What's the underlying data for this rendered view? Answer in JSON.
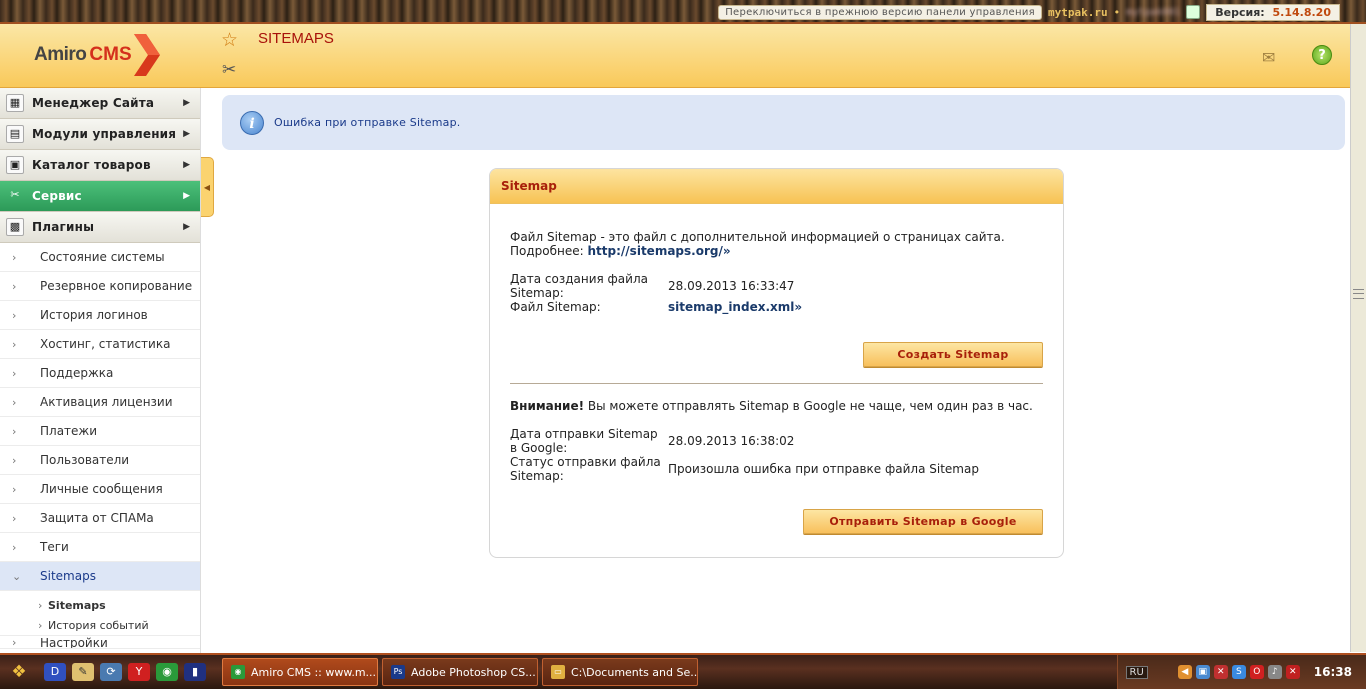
{
  "topbar": {
    "switch_label": "Переключиться в прежнюю версию панели управления",
    "site": "mytpak.ru",
    "user": "mytpak001",
    "version_label": "Версия:",
    "version": "5.14.8.20"
  },
  "header": {
    "logo_a": "Amiro",
    "logo_b": "CMS",
    "title": "SITEMAPS",
    "colors": {
      "title": "#a8120a",
      "header_bg": "#f9c95a"
    }
  },
  "sidebar": {
    "sections": [
      {
        "label": "Менеджер Сайта",
        "icon": "site-manager-icon"
      },
      {
        "label": "Модули управления",
        "icon": "modules-icon"
      },
      {
        "label": "Каталог товаров",
        "icon": "catalog-icon"
      },
      {
        "label": "Сервис",
        "icon": "service-tools-icon",
        "active": true
      },
      {
        "label": "Плагины",
        "icon": "plugins-icon"
      }
    ],
    "items": [
      "Состояние системы",
      "Резервное копирование",
      "История логинов",
      "Хостинг, статистика",
      "Поддержка",
      "Активация лицензии",
      "Платежи",
      "Пользователи",
      "Личные сообщения",
      "Защита от СПАМа",
      "Теги",
      "Sitemaps"
    ],
    "subitems": [
      "Sitemaps",
      "История событий"
    ],
    "next_partial": "Настройки"
  },
  "banner": {
    "text": "Ошибка при отправке Sitemap."
  },
  "panel": {
    "title": "Sitemap",
    "desc": "Файл Sitemap - это файл с дополнительной информацией о страницах сайта.",
    "more_label": "Подробнее:",
    "more_link": "http://sitemaps.org/»",
    "created_label": "Дата создания файла Sitemap:",
    "created_value": "28.09.2013 16:33:47",
    "file_label": "Файл Sitemap:",
    "file_value": "sitemap_index.xml»",
    "create_button": "Создать Sitemap",
    "warning_bold": "Внимание!",
    "warning_text": " Вы можете отправлять Sitemap в Google не чаще, чем один раз в час.",
    "sent_label": "Дата отправки Sitemap в Google:",
    "sent_value": "28.09.2013 16:38:02",
    "status_label": "Статус отправки файла Sitemap:",
    "status_value": "Произошла ошибка при отправке файла Sitemap",
    "send_button": "Отправить Sitemap в Google"
  },
  "taskbar": {
    "tasks": [
      {
        "label": "Amiro CMS :: www.m...",
        "icon": "chrome-icon",
        "active": true
      },
      {
        "label": "Adobe Photoshop CS...",
        "icon": "photoshop-icon"
      },
      {
        "label": "C:\\Documents and Se...",
        "icon": "folder-icon"
      }
    ],
    "lang": "RU",
    "clock": "16:38"
  }
}
